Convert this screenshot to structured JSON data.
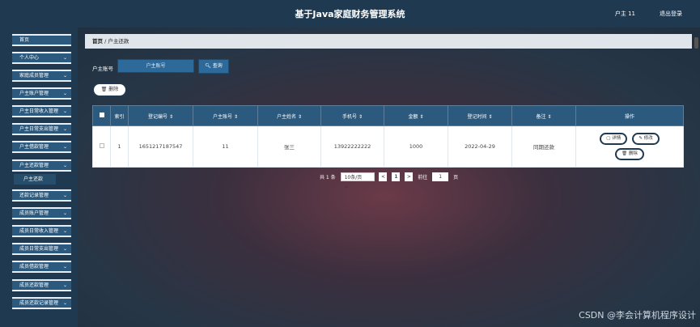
{
  "header": {
    "title": "基于Java家庭财务管理系统",
    "user": "户主 11",
    "logout": "退出登录"
  },
  "sidebar": {
    "items": [
      {
        "label": "首页",
        "chevron": false
      },
      {
        "label": "个人中心",
        "chevron": true
      },
      {
        "label": "家庭成员管理",
        "chevron": true
      },
      {
        "label": "户主账户管理",
        "chevron": true
      },
      {
        "label": "户主日常收入管理",
        "chevron": true
      },
      {
        "label": "户主日常支出管理",
        "chevron": true
      },
      {
        "label": "户主借款管理",
        "chevron": true
      },
      {
        "label": "户主还款管理",
        "chevron": true
      },
      {
        "label": "户主还款",
        "chevron": false,
        "sub": true
      },
      {
        "label": "还款记录管理",
        "chevron": true
      },
      {
        "label": "成员账户管理",
        "chevron": true
      },
      {
        "label": "成员日常收入管理",
        "chevron": true
      },
      {
        "label": "成员日常支出管理",
        "chevron": true
      },
      {
        "label": "成员借款管理",
        "chevron": true
      },
      {
        "label": "成员还款管理",
        "chevron": true
      },
      {
        "label": "成员还款记录管理",
        "chevron": true
      }
    ]
  },
  "breadcrumb": {
    "home": "首页",
    "sep": "/",
    "current": "户主还款"
  },
  "search": {
    "label": "户主账号",
    "placeholder": "户主账号",
    "button": "查询"
  },
  "actions": {
    "delete": "删除"
  },
  "table": {
    "headers": [
      "索引",
      "登记编号",
      "户主账号",
      "户主姓名",
      "手机号",
      "金额",
      "登记时间",
      "备注",
      "操作"
    ],
    "rows": [
      [
        "1",
        "1651217187547",
        "11",
        "张三",
        "13922222222",
        "1000",
        "2022-04-29",
        "同期还款"
      ]
    ],
    "row_actions": {
      "detail": "详情",
      "edit": "修改",
      "delete": "删除"
    }
  },
  "pagination": {
    "total": "共 1 条",
    "page_size": "10条/页",
    "prev": "<",
    "current": "1",
    "next": ">",
    "goto_label": "前往",
    "goto_value": "1",
    "page_suffix": "页"
  },
  "watermark": "CSDN @李会计算机程序设计",
  "colors": {
    "header": "#1f3a50",
    "accent": "#2c5a7e"
  }
}
